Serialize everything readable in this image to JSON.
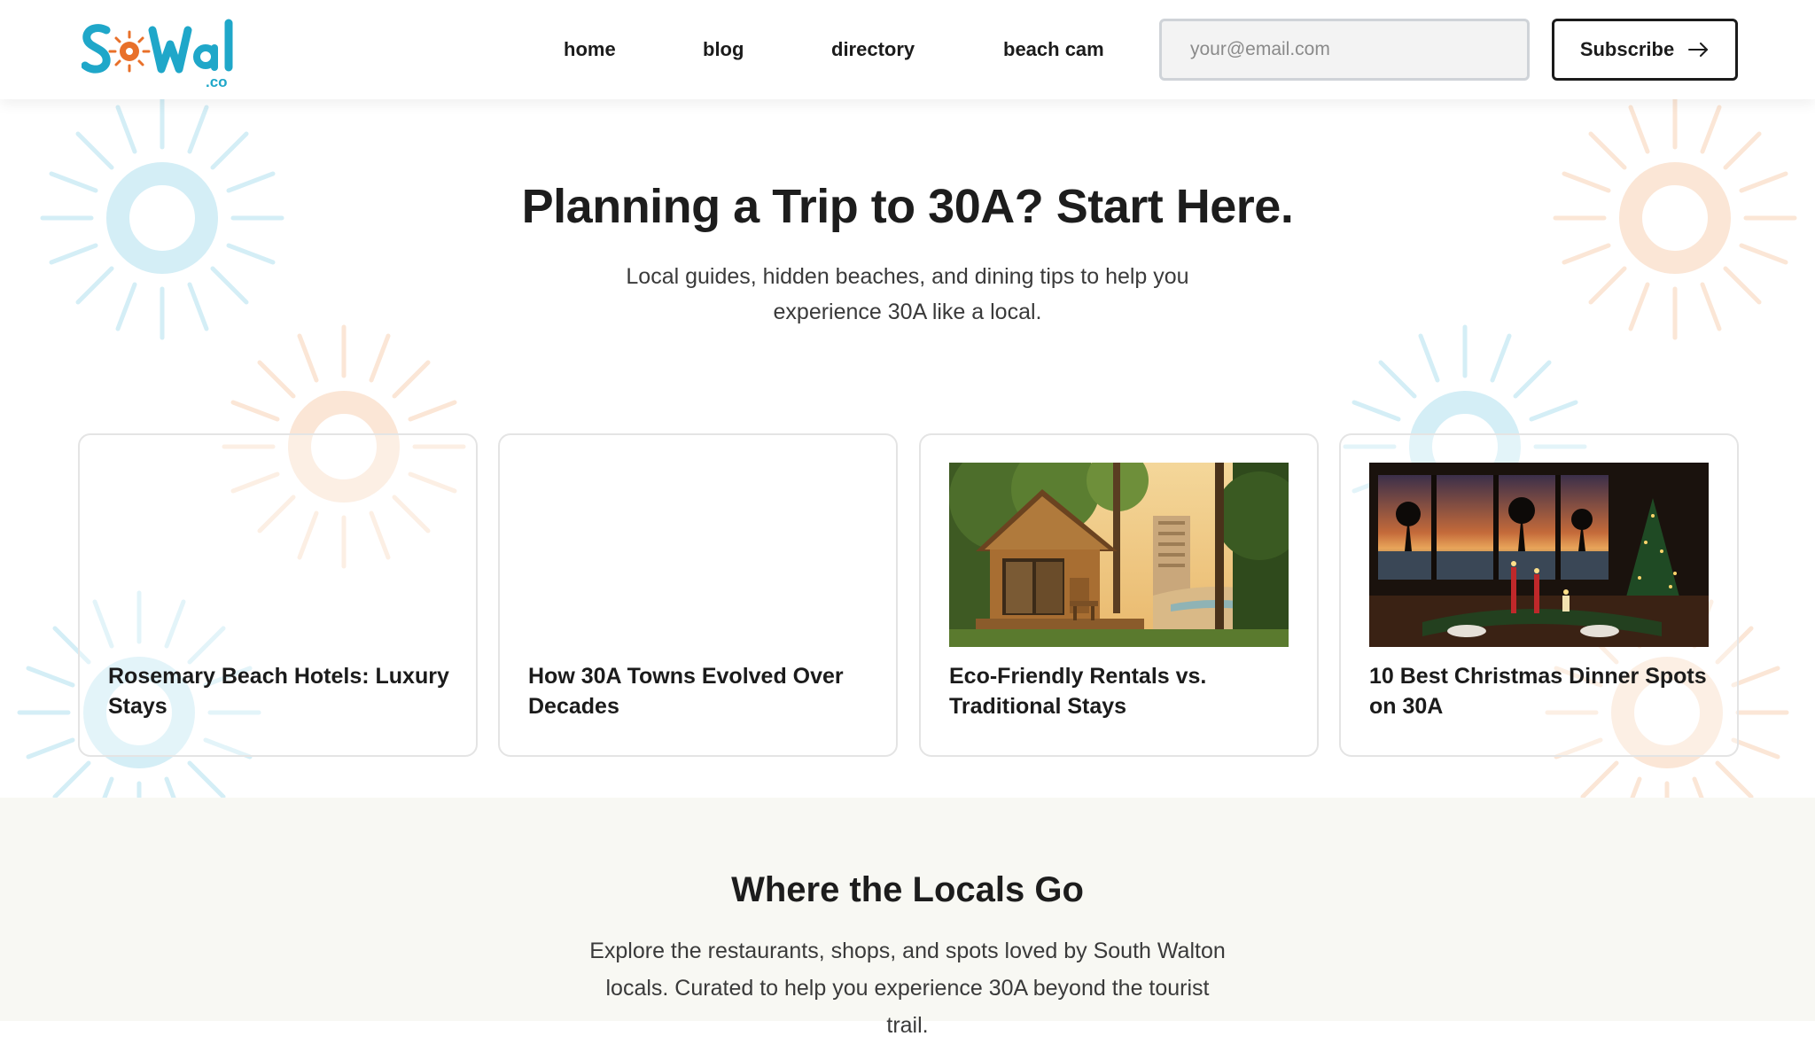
{
  "brand": {
    "logo_text": "SoWal",
    "logo_suffix": ".co",
    "colors": {
      "teal": "#1fa7c9",
      "orange": "#e8702a"
    }
  },
  "nav": {
    "items": [
      {
        "label": "home"
      },
      {
        "label": "blog"
      },
      {
        "label": "directory"
      },
      {
        "label": "beach cam"
      }
    ]
  },
  "subscribe": {
    "email_placeholder": "your@email.com",
    "email_value": "",
    "button_label": "Subscribe",
    "button_icon": "arrow-right-icon"
  },
  "hero": {
    "title": "Planning a Trip to 30A? Start Here.",
    "subtitle": "Local guides, hidden beaches, and dining tips to help you experience 30A like a local."
  },
  "cards": [
    {
      "title": "Rosemary Beach Hotels: Luxury Stays",
      "has_image": false
    },
    {
      "title": "How 30A Towns Evolved Over Decades",
      "has_image": false
    },
    {
      "title": "Eco-Friendly Rentals vs. Traditional Stays",
      "has_image": true,
      "image_subject": "wooden cabin in forest near beach at sunset"
    },
    {
      "title": "10 Best Christmas Dinner Spots on 30A",
      "has_image": true,
      "image_subject": "restaurant dining table with candles and Christmas tree facing ocean sunset"
    }
  ],
  "locals": {
    "title": "Where the Locals Go",
    "text": "Explore the restaurants, shops, and spots loved by South Walton locals. Curated to help you experience 30A beyond the tourist trail."
  },
  "decor": {
    "sun_teal": "#d4eef6",
    "sun_orange": "#fbe6d6"
  }
}
